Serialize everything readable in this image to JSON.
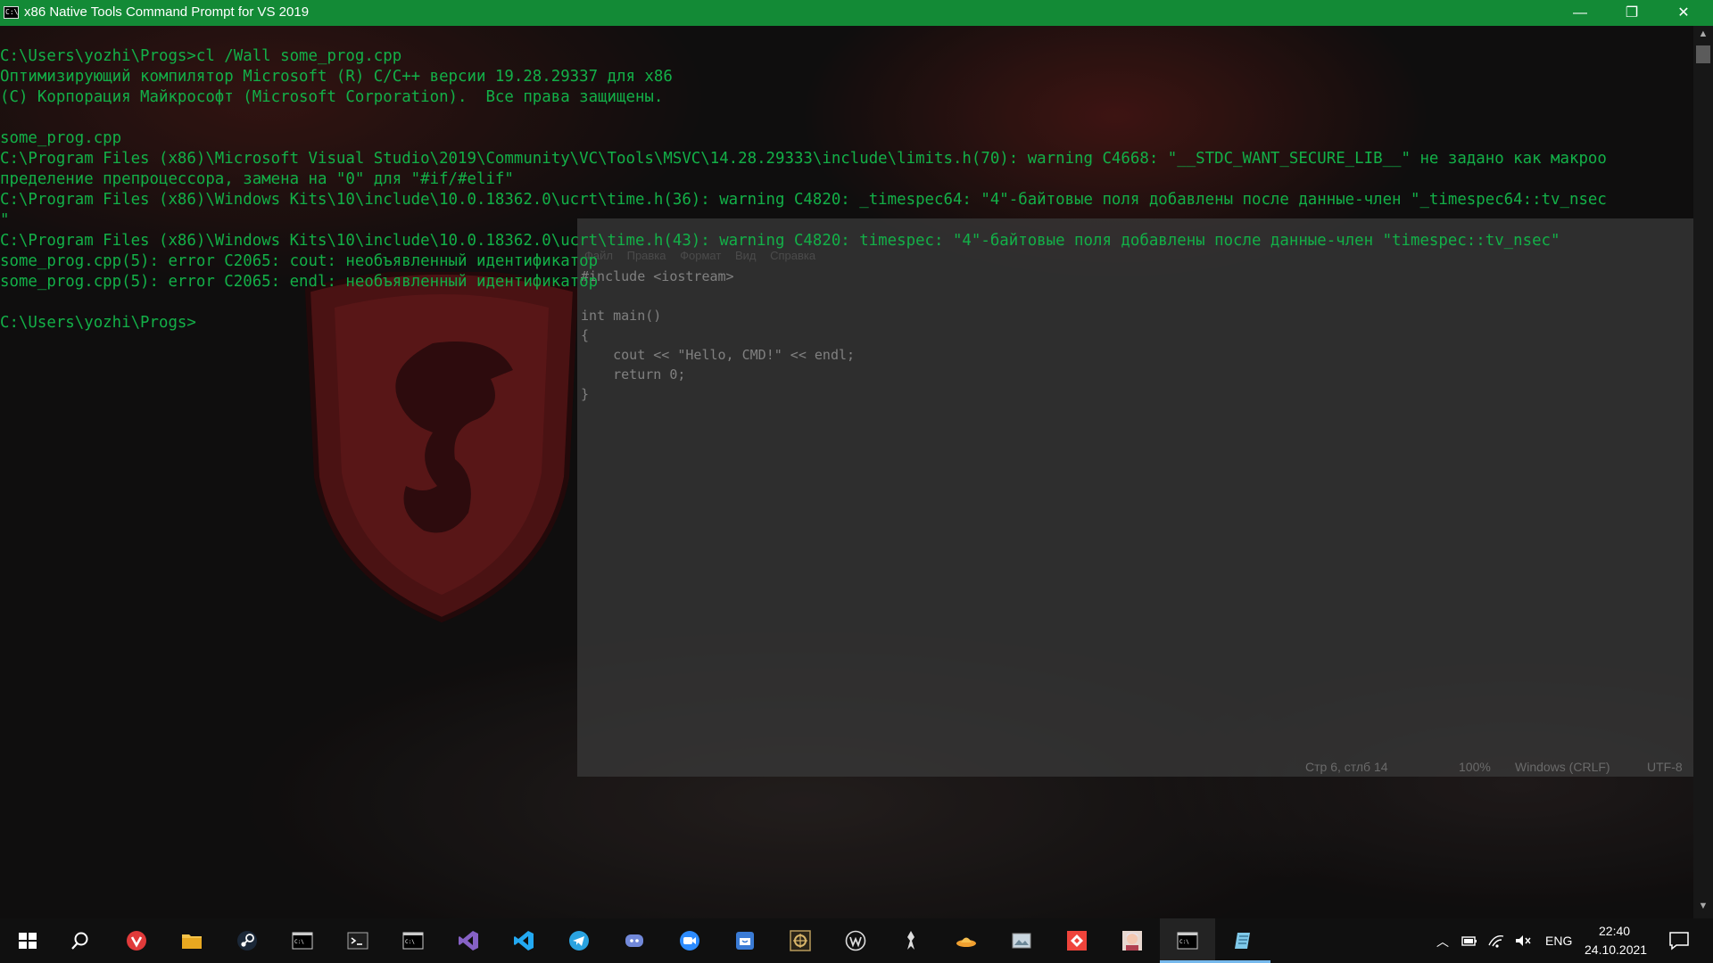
{
  "window": {
    "title": "x86 Native Tools Command Prompt for VS 2019",
    "icon_label": "C:\\",
    "minimize": "—",
    "maximize": "❐",
    "close": "✕"
  },
  "console": {
    "lines": [
      "C:\\Users\\yozhi\\Progs>cl /Wall some_prog.cpp",
      "Оптимизирующий компилятор Microsoft (R) C/C++ версии 19.28.29337 для x86",
      "(C) Корпорация Майкрософт (Microsoft Corporation).  Все права защищены.",
      "",
      "some_prog.cpp",
      "C:\\Program Files (x86)\\Microsoft Visual Studio\\2019\\Community\\VC\\Tools\\MSVC\\14.28.29333\\include\\limits.h(70): warning C4668: \"__STDC_WANT_SECURE_LIB__\" не задано как макроо",
      "пределение препроцессора, замена на \"0\" для \"#if/#elif\"",
      "C:\\Program Files (x86)\\Windows Kits\\10\\include\\10.0.18362.0\\ucrt\\time.h(36): warning C4820: _timespec64: \"4\"-байтовые поля добавлены после данные-член \"_timespec64::tv_nsec",
      "\"",
      "C:\\Program Files (x86)\\Windows Kits\\10\\include\\10.0.18362.0\\ucrt\\time.h(43): warning C4820: timespec: \"4\"-байтовые поля добавлены после данные-член \"timespec::tv_nsec\"",
      "some_prog.cpp(5): error C2065: cout: необъявленный идентификатор",
      "some_prog.cpp(5): error C2065: endl: необъявленный идентификатор",
      "",
      "C:\\Users\\yozhi\\Progs>"
    ],
    "text_color": "#13b048"
  },
  "notepad": {
    "menu": [
      "Файл",
      "Правка",
      "Формат",
      "Вид",
      "Справка"
    ],
    "code": [
      "#include <iostream>",
      "",
      "int main()",
      "{",
      "    cout << \"Hello, CMD!\" << endl;",
      "    return 0;",
      "}"
    ],
    "status": {
      "position": "Стр 6, стлб 14",
      "zoom": "100%",
      "line_endings": "Windows (CRLF)",
      "encoding": "UTF-8"
    }
  },
  "taskbar": {
    "apps": [
      {
        "name": "start-button",
        "icon": "windows-logo-icon"
      },
      {
        "name": "search-button",
        "icon": "search-icon"
      },
      {
        "name": "vivaldi",
        "icon": "vivaldi-icon"
      },
      {
        "name": "file-explorer",
        "icon": "folder-icon"
      },
      {
        "name": "steam",
        "icon": "steam-icon"
      },
      {
        "name": "command-prompt-1",
        "icon": "console-icon"
      },
      {
        "name": "powershell",
        "icon": "terminal-icon"
      },
      {
        "name": "command-prompt-2",
        "icon": "console-icon"
      },
      {
        "name": "visual-studio",
        "icon": "visual-studio-icon"
      },
      {
        "name": "vs-code",
        "icon": "vscode-icon"
      },
      {
        "name": "telegram",
        "icon": "telegram-icon"
      },
      {
        "name": "discord",
        "icon": "discord-icon"
      },
      {
        "name": "zoom",
        "icon": "zoom-icon"
      },
      {
        "name": "store-app",
        "icon": "store-icon"
      },
      {
        "name": "game-app",
        "icon": "game-icon"
      },
      {
        "name": "wot-app",
        "icon": "w-logo-icon"
      },
      {
        "name": "skyrim-app",
        "icon": "skyrim-icon"
      },
      {
        "name": "hat-app",
        "icon": "hat-icon"
      },
      {
        "name": "photos-app",
        "icon": "photos-icon"
      },
      {
        "name": "anydesk-app",
        "icon": "anydesk-icon"
      },
      {
        "name": "anime-app",
        "icon": "avatar-icon"
      },
      {
        "name": "command-prompt-active",
        "icon": "console-icon"
      },
      {
        "name": "notepad",
        "icon": "notepad-icon"
      }
    ],
    "tray": {
      "language": "ENG",
      "time": "22:40",
      "date": "24.10.2021"
    },
    "accent_color": "#76b9ed"
  },
  "colors": {
    "titlebar": "#138a36",
    "console_text": "#13b048"
  }
}
